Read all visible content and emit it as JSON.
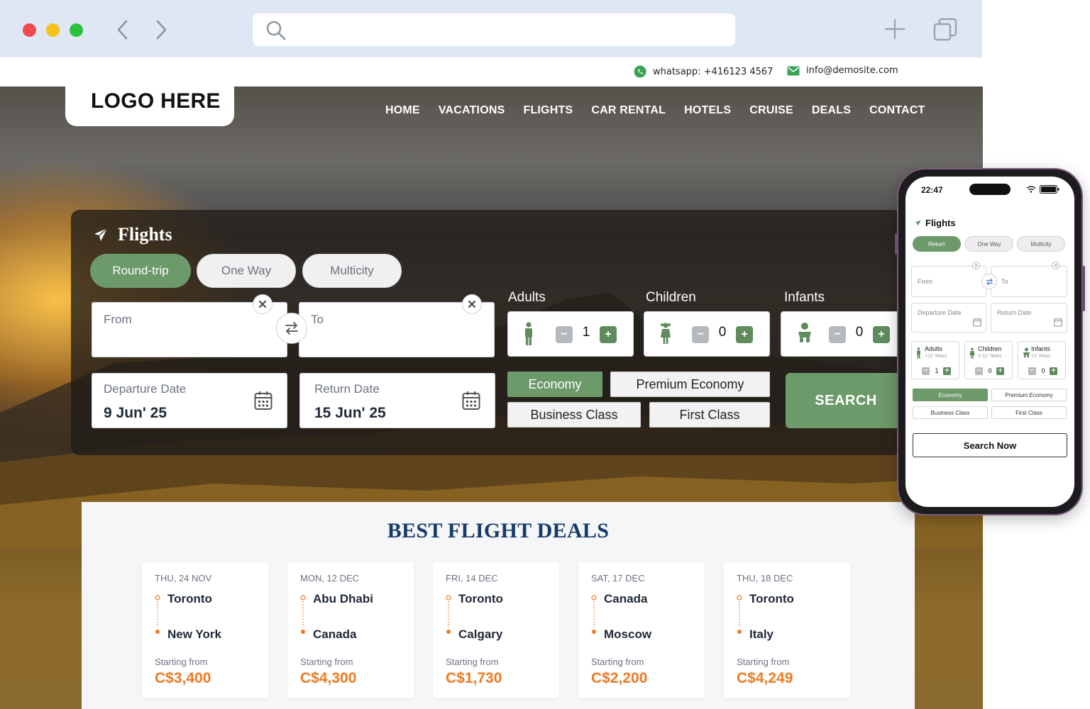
{
  "colors": {
    "accent_green": "#6c9a6a",
    "deal_price_orange": "#f07a22",
    "deals_title_navy": "#163a6a",
    "browser_bar": "#dee7f3"
  },
  "browser": {
    "url_value": "",
    "icons": [
      "back-arrow-icon",
      "forward-arrow-icon",
      "search-icon",
      "plus-icon",
      "tabs-icon"
    ]
  },
  "contact": {
    "whatsapp": "whatsapp: +416123 4567",
    "email": "info@demosite.com"
  },
  "header": {
    "logo": "LOGO HERE",
    "nav": [
      "HOME",
      "VACATIONS",
      "FLIGHTS",
      "CAR RENTAL",
      "HOTELS",
      "CRUISE",
      "DEALS",
      "CONTACT"
    ]
  },
  "search_widget": {
    "title": "Flights",
    "trip_types": [
      "Round-trip",
      "One Way",
      "Multicity"
    ],
    "selected_trip_type": "Round-trip",
    "from_label": "From",
    "to_label": "To",
    "departure_label": "Departure Date",
    "departure_value": "9 Jun' 25",
    "return_label": "Return Date",
    "return_value": "15 Jun' 25",
    "passengers": [
      {
        "label": "Adults",
        "count": "1"
      },
      {
        "label": "Children",
        "count": "0"
      },
      {
        "label": "Infants",
        "count": "0"
      }
    ],
    "cabins": [
      "Economy",
      "Premium Economy",
      "Business Class",
      "First Class"
    ],
    "selected_cabin": "Economy",
    "search_label": "SEARCH"
  },
  "deals": {
    "title": "BEST FLIGHT DEALS",
    "starting_label": "Starting from",
    "items": [
      {
        "date": "THU, 24 NOV",
        "from": "Toronto",
        "to": "New York",
        "price": "C$3,400"
      },
      {
        "date": "MON, 12 DEC",
        "from": "Abu Dhabi",
        "to": "Canada",
        "price": "C$4,300"
      },
      {
        "date": "FRI, 14 DEC",
        "from": "Toronto",
        "to": "Calgary",
        "price": "C$1,730"
      },
      {
        "date": "SAT, 17 DEC",
        "from": "Canada",
        "to": "Moscow",
        "price": "C$2,200"
      },
      {
        "date": "THU, 18 DEC",
        "from": "Toronto",
        "to": "Italy",
        "price": "C$4,249"
      }
    ]
  },
  "mobile": {
    "time": "22:47",
    "title": "Flights",
    "trip_types": [
      "Return",
      "One Way",
      "Multicity"
    ],
    "from_label": "From",
    "to_label": "To",
    "departure_label": "Departure Date",
    "return_label": "Return Date",
    "passengers": [
      {
        "label": "Adults",
        "age": ">12 Years",
        "count": "1"
      },
      {
        "label": "Children",
        "age": "2-12 Years",
        "count": "0"
      },
      {
        "label": "Infants",
        "age": "<2 Years",
        "count": "0"
      }
    ],
    "cabins": [
      "Economy",
      "Premium Economy",
      "Business Class",
      "First Class"
    ],
    "search_label": "Search Now"
  }
}
